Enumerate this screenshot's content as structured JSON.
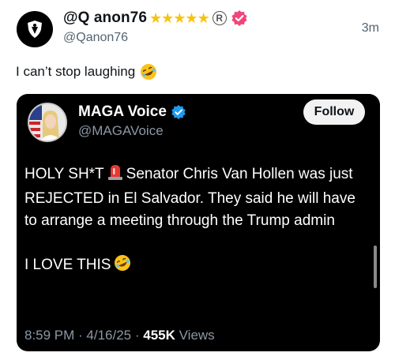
{
  "post": {
    "display_name": "@Q anon76",
    "stars": "★★★★★",
    "registered_mark": "R",
    "handle": "@Qanon76",
    "time_ago": "3m",
    "text": "I can’t stop laughing"
  },
  "quoted": {
    "display_name": "MAGA Voice",
    "handle": "@MAGAVoice",
    "follow_label": "Follow",
    "line1_before_siren": "HOLY SH*T",
    "line1_after_siren": "Senator Chris Van Hollen was just REJECTED in El Salvador. They said he will have to arrange a meeting through the Trump admin",
    "line2": "I LOVE THIS",
    "time": "8:59 PM",
    "date": "4/16/25",
    "views_count": "455K",
    "views_label": "Views"
  },
  "icons": {
    "outer_avatar": "qanon-shield-icon",
    "pink_badge": "pink-verified-icon",
    "verified": "blue-verified-icon",
    "siren": "siren-emoji-icon",
    "laughing": "rolling-laughing-emoji-icon"
  },
  "colors": {
    "star": "#f7c30f",
    "pink_badge": "#f0467a",
    "verified_blue": "#1d9bf0",
    "card_bg": "#000000",
    "follow_bg": "#f2f2f2"
  }
}
